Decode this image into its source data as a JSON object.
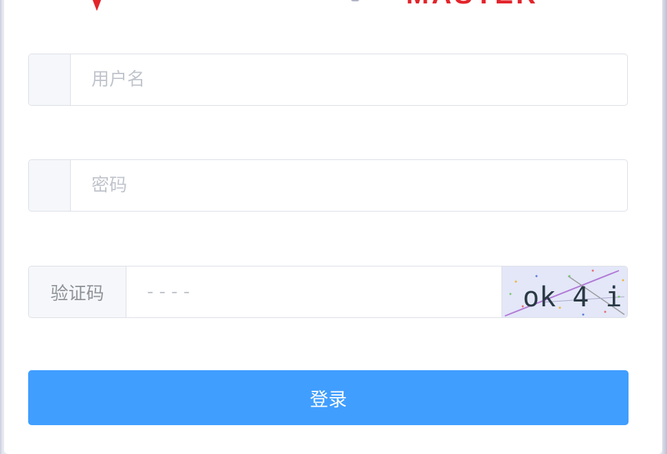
{
  "logo": {
    "text": "MASTER",
    "pin_color": "#e3242b"
  },
  "form": {
    "username": {
      "placeholder": "用户名",
      "value": ""
    },
    "password": {
      "placeholder": "密码",
      "value": ""
    },
    "captcha": {
      "label": "验证码",
      "placeholder": "- - - -",
      "value": "",
      "image_text": "ok 4 i"
    },
    "submit_label": "登录"
  },
  "colors": {
    "primary": "#409eff",
    "border": "#dcdfe6",
    "prepend_bg": "#f5f7fa",
    "brand_red": "#e3242b"
  }
}
